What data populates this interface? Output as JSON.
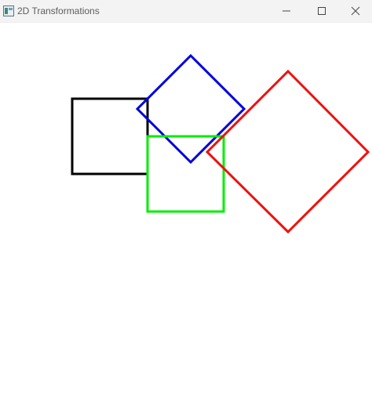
{
  "window": {
    "title": "2D Transformations"
  },
  "title_bar": {
    "buttons": [
      "minimize",
      "maximize",
      "close"
    ]
  },
  "canvas": {
    "background": "#ffffff",
    "shapes": [
      {
        "name": "black-square",
        "color": "#000000",
        "kind": "square"
      },
      {
        "name": "blue-diamond",
        "color": "#0000dd",
        "kind": "rotated-square"
      },
      {
        "name": "green-square",
        "color": "#00ee00",
        "kind": "square"
      },
      {
        "name": "red-diamond",
        "color": "#ee1111",
        "kind": "rotated-square"
      }
    ]
  }
}
